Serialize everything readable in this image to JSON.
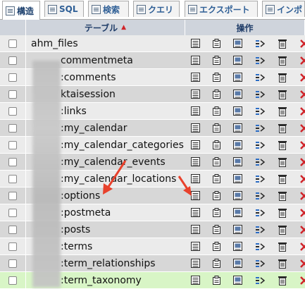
{
  "tabs": [
    {
      "label": "構造",
      "icon": "structure-icon",
      "active": true
    },
    {
      "label": "SQL",
      "icon": "sql-icon",
      "active": false
    },
    {
      "label": "検索",
      "icon": "search-icon",
      "active": false
    },
    {
      "label": "クエリ",
      "icon": "query-icon",
      "active": false
    },
    {
      "label": "エクスポート",
      "icon": "export-icon",
      "active": false
    },
    {
      "label": "インポ",
      "icon": "import-icon",
      "active": false
    }
  ],
  "table": {
    "header_table": "テーブル",
    "header_sort_indicator": "▲",
    "header_actions": "操作",
    "rows": [
      {
        "name": "ahm_files",
        "checked": false
      },
      {
        "name": "commentmeta",
        "checked": false
      },
      {
        "name": ":comments",
        "checked": false
      },
      {
        "name": "ktaisession",
        "checked": false
      },
      {
        "name": ":links",
        "checked": false
      },
      {
        "name": ":my_calendar",
        "checked": false
      },
      {
        "name": ":my_calendar_categories",
        "checked": false
      },
      {
        "name": ":my_calendar_events",
        "checked": false
      },
      {
        "name": ":my_calendar_locations",
        "checked": false
      },
      {
        "name": ":options",
        "checked": false
      },
      {
        "name": ":postmeta",
        "checked": false
      },
      {
        "name": ":posts",
        "checked": false
      },
      {
        "name": ":terms",
        "checked": false
      },
      {
        "name": ":term_relationships",
        "checked": false
      },
      {
        "name": ":term_taxonomy",
        "checked": false
      }
    ],
    "actions": [
      "browse-icon",
      "structure-icon",
      "search-icon",
      "insert-icon",
      "empty-icon",
      "drop-icon"
    ]
  },
  "colors": {
    "header_bg": "#cfd4dc",
    "row_odd": "#ebebeb",
    "row_even": "#d7d7d7",
    "row_highlight": "#d8f5c6",
    "annotation_arrow": "#e8412c",
    "drop_icon": "#d0242a"
  }
}
